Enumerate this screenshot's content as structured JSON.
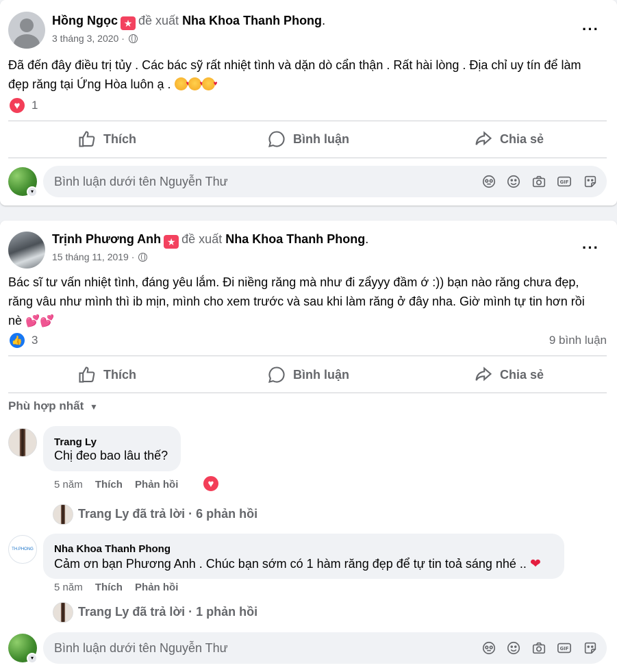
{
  "posts": [
    {
      "author": "Hồng Ngọc",
      "recommend_text": "đề xuất",
      "page": "Nha Khoa Thanh Phong",
      "date": "3 tháng 3, 2020",
      "text_line1": "Đã đến đây điều trị tủy . Các bác sỹ rất nhiệt tình và dặn dò cẩn thận . Rất hài lòng . Địa chỉ uy tín để làm",
      "text_line2": "đẹp răng tại Ứng Hòa luôn ạ .",
      "reaction_count": "1",
      "actions": {
        "like": "Thích",
        "comment": "Bình luận",
        "share": "Chia sẻ"
      },
      "comment_placeholder": "Bình luận dưới tên Nguyễn Thư"
    },
    {
      "author": "Trịnh Phương Anh",
      "recommend_text": "đề xuất",
      "page": "Nha Khoa Thanh Phong",
      "date": "15 tháng 11, 2019",
      "text_line1": "Bác sĩ tư vấn nhiệt tình, đáng yêu lắm. Đi niềng răng mà như đi zẩyyy đầm ớ :)) bạn nào răng chưa đẹp,",
      "text_line2": "răng vâu như mình thì ib mịn, mình cho xem trước và sau khi làm răng ở đây nha. Giờ mình tự tin hơn rồi",
      "text_line3": "nè",
      "reaction_count": "3",
      "comment_count": "9 bình luận",
      "actions": {
        "like": "Thích",
        "comment": "Bình luận",
        "share": "Chia sẻ"
      },
      "sort_label": "Phù hợp nhất",
      "comments": [
        {
          "name": "Trang Ly",
          "text": "Chị đeo bao lâu thế?",
          "time": "5 năm",
          "like": "Thích",
          "reply": "Phản hồi",
          "replies_text": "Trang Ly đã trả lời · 6 phản hồi"
        },
        {
          "name": "Nha Khoa Thanh Phong",
          "text": "Cảm ơn bạn Phương Anh . Chúc bạn sớm có 1 hàm răng đẹp để tự tin toả sáng nhé ..",
          "time": "5 năm",
          "like": "Thích",
          "reply": "Phản hồi",
          "replies_text": "Trang Ly đã trả lời · 1 phản hồi",
          "avatar_text": "TH.PHONG"
        }
      ],
      "comment_placeholder": "Bình luận dưới tên Nguyễn Thư"
    }
  ]
}
